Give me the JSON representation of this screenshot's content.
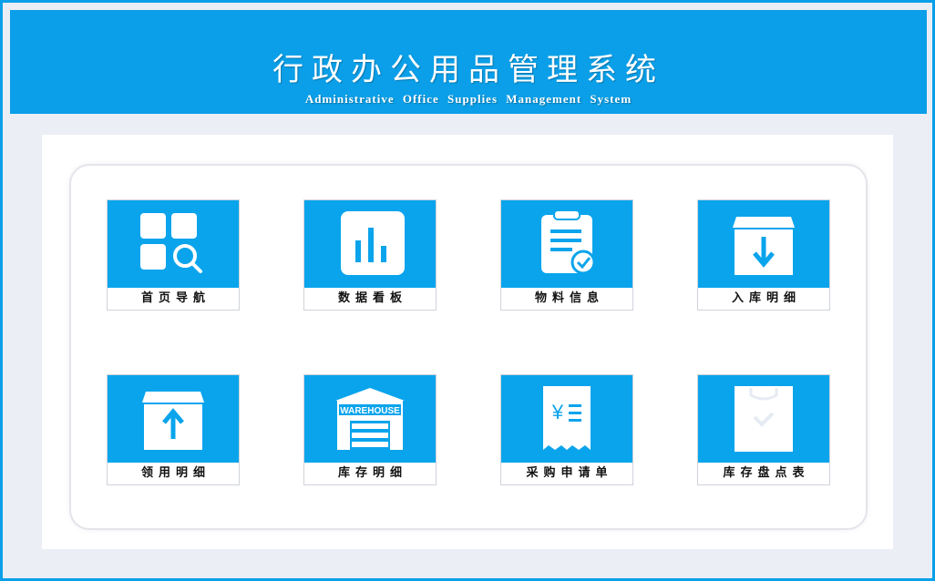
{
  "header": {
    "title": "行政办公用品管理系统",
    "subtitle": "Administrative Office Supplies Management System"
  },
  "tiles": [
    {
      "label": "首页导航",
      "icon": "dashboard-grid-search-icon"
    },
    {
      "label": "数据看板",
      "icon": "bar-chart-icon"
    },
    {
      "label": "物料信息",
      "icon": "clipboard-check-icon"
    },
    {
      "label": "入库明细",
      "icon": "box-arrow-down-icon"
    },
    {
      "label": "领用明细",
      "icon": "box-arrow-up-icon"
    },
    {
      "label": "库存明细",
      "icon": "warehouse-icon",
      "icon_text": "WAREHOUSE"
    },
    {
      "label": "采购申请单",
      "icon": "yen-receipt-icon",
      "icon_text": "¥"
    },
    {
      "label": "库存盘点表",
      "icon": "shopping-bag-check-icon"
    }
  ],
  "colors": {
    "header_bg": "#0a9fe8",
    "tile_bg": "#0aa4ec",
    "panel_bg": "#ffffff",
    "page_bg": "#eceef6"
  }
}
